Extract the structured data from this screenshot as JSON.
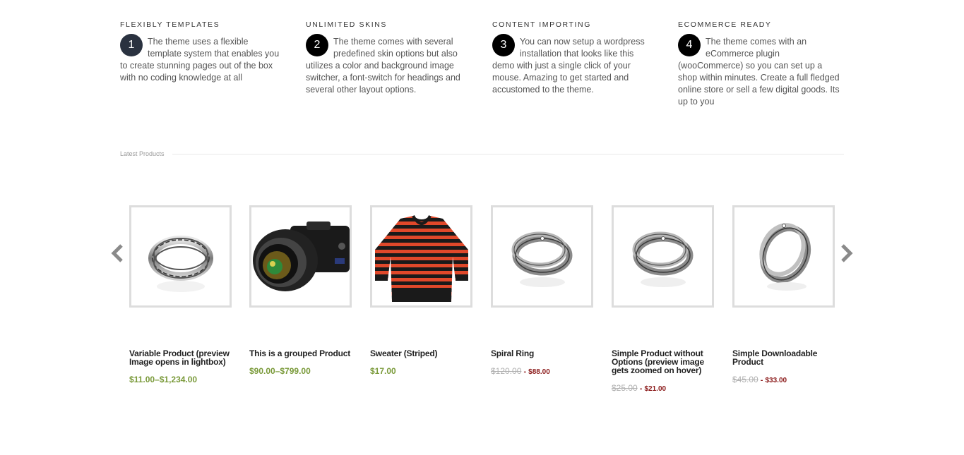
{
  "features": [
    {
      "number": "1",
      "title": "FLEXIBLY TEMPLATES",
      "text": "The theme uses a flexible template system that enables you to create stunning pages out of the box with no coding knowledge at all"
    },
    {
      "number": "2",
      "title": "UNLIMITED SKINS",
      "text": "The theme comes with several predefined skin options but also utilizes a color and background image switcher, a font-switch for headings and several other layout options."
    },
    {
      "number": "3",
      "title": "CONTENT IMPORTING",
      "text": "You can now setup a wordpress installation that looks like this demo with just a single click of your mouse. Amazing to get started and accustomed to the theme."
    },
    {
      "number": "4",
      "title": "ECOMMERCE READY",
      "text": "The theme comes with an eCommerce plugin (wooCommerce) so you can set up a shop within minutes. Create a full fledged online store or sell a few digital goods. Its up to you"
    }
  ],
  "latest_products_label": "Latest Products",
  "carousel": {
    "prev_icon": "chevron-left-icon",
    "next_icon": "chevron-right-icon"
  },
  "products": [
    {
      "title": "Variable Product (preview Image opens in lightbox)",
      "price": "$11.00–$1,234.00",
      "image": "ring-grooved-icon"
    },
    {
      "title": "This is a grouped Product",
      "price": "$90.00–$799.00",
      "image": "camera-icon"
    },
    {
      "title": "Sweater (Striped)",
      "price": "$17.00",
      "image": "striped-sweater-icon"
    },
    {
      "title": "Spiral Ring",
      "old_price": "$120.00",
      "sep": " - ",
      "sale_price": "$88.00",
      "image": "spiral-ring-icon"
    },
    {
      "title": "Simple Product without Options (preview image gets zoomed on hover)",
      "old_price": "$25.00",
      "sep": " - ",
      "sale_price": "$21.00",
      "image": "spiral-ring-icon"
    },
    {
      "title": "Simple Downloadable Product",
      "old_price": "$45.00",
      "sep": " - ",
      "sale_price": "$33.00",
      "image": "spiral-ring-tilted-icon"
    }
  ],
  "colors": {
    "accent_green": "#7a9a3a",
    "sale_red": "#8b1a1a",
    "number_badge": "#000000",
    "number_badge_first": "#2a3240"
  }
}
